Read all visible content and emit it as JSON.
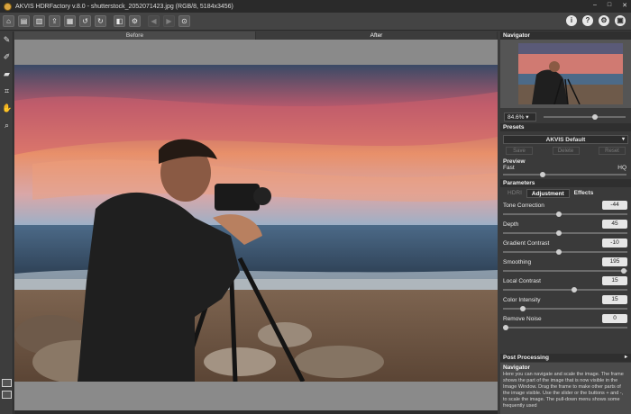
{
  "window": {
    "title": "AKVIS HDRFactory v.8.0 - shutterstock_2052071423.jpg (RGB/8, 5184x3456)",
    "minimize": "–",
    "maximize": "□",
    "close": "✕"
  },
  "toolbar": {
    "buttons": [
      "home-icon",
      "open-icon",
      "save-icon",
      "export-icon",
      "print-icon",
      "undo-icon",
      "redo-icon",
      "before-after-icon",
      "settings-icon",
      "back-icon",
      "forward-icon",
      "run-icon"
    ],
    "right_buttons": [
      "info-icon",
      "help-icon",
      "preferences-icon",
      "close-panel-icon"
    ]
  },
  "left_tools": [
    "dropper-icon",
    "brush-icon",
    "eraser-icon",
    "crop-icon",
    "hand-icon",
    "zoom-icon"
  ],
  "view_tabs": {
    "before": "Before",
    "after": "After",
    "active": "after"
  },
  "navigator": {
    "header": "Navigator",
    "zoom": "84.6%",
    "zoom_level": 0.63
  },
  "presets": {
    "header": "Presets",
    "selected": "AKVIS Default",
    "save": "Save",
    "delete": "Delete",
    "reset": "Reset"
  },
  "preview": {
    "label": "Preview",
    "fast": "Fast",
    "hq": "HQ",
    "level": 0.32
  },
  "parameters": {
    "header": "Parameters",
    "tabs": [
      "HDRI",
      "Adjustment",
      "Effects"
    ],
    "active_tab": "Adjustment",
    "items": [
      {
        "name": "Tone Correction",
        "value": "-44",
        "level": 0.45
      },
      {
        "name": "Depth",
        "value": "45",
        "level": 0.45
      },
      {
        "name": "Gradient Contrast",
        "value": "-10",
        "level": 0.45
      },
      {
        "name": "Smoothing",
        "value": "195",
        "level": 0.97
      },
      {
        "name": "Local Contrast",
        "value": "15",
        "level": 0.57
      },
      {
        "name": "Color Intensity",
        "value": "15",
        "level": 0.16
      },
      {
        "name": "Remove Noise",
        "value": "0",
        "level": 0.02
      }
    ]
  },
  "post_processing": {
    "header": "Post Processing"
  },
  "help": {
    "title": "Navigator",
    "text": "Here you can navigate and scale the image. The frame shows the part of the image that is now visible in the Image Window. Drag the frame to make other parts of the image visible. Use the slider or the buttons + and -, to scale the image. The pull-down menu shows some frequently used"
  },
  "colors": {
    "panel_bg": "#3a3a3a",
    "header_bg": "#2f2f2f",
    "canvas_bg": "#8a8a8a"
  }
}
